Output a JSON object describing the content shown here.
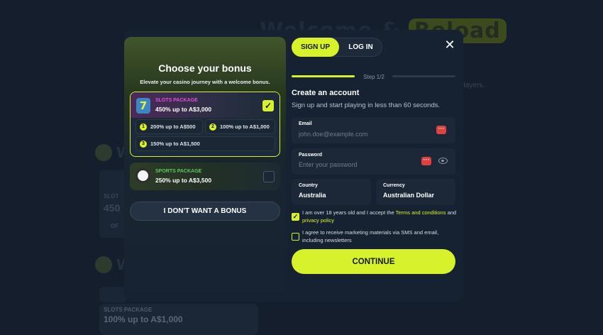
{
  "background": {
    "title_part1": "Welcome &",
    "title_part2": "Reload",
    "subtitle_fragment": "players.",
    "bonus_icon_1_text": "W",
    "bonus_icon_2_text": "W",
    "card1_label": "SLOT",
    "card1_amount": "450",
    "card1_chip": "OF",
    "banner_label": "SLOTS PACKAGE",
    "banner_amount": "100% up to A$1,000"
  },
  "bonus": {
    "title": "Choose your bonus",
    "subtitle": "Elevate your casino journey with a welcome bonus.",
    "slots": {
      "label": "SLOTS PACKAGE",
      "amount": "450% up to A$3,000",
      "icon_glyph": "7",
      "selected": true,
      "tiers": [
        {
          "num": "1",
          "text": "200% up to A$500"
        },
        {
          "num": "2",
          "text": "100% up to A$1,000"
        },
        {
          "num": "3",
          "text": "150% up to A$1,500"
        }
      ]
    },
    "sports": {
      "label": "SPORTS PACKAGE",
      "amount": "250% up to A$3,500",
      "selected": false
    },
    "no_bonus_label": "I DON'T WANT A BONUS"
  },
  "auth": {
    "tabs": {
      "signup": "SIGN UP",
      "login": "LOG IN"
    },
    "close_glyph": "✕",
    "step": "Step 1/2",
    "title": "Create an account",
    "subtitle": "Sign up and start playing in less than 60 seconds.",
    "email": {
      "label": "Email",
      "placeholder": "john.doe@example.com"
    },
    "password": {
      "label": "Password",
      "placeholder": "Enter your password"
    },
    "country": {
      "label": "Country",
      "value": "Australia"
    },
    "currency": {
      "label": "Currency",
      "value": "Australian Dollar"
    },
    "terms": {
      "checked": true,
      "text_before": "I am over 18 years old and I accept the ",
      "link1": "Terms and conditions",
      "text_mid": " and ",
      "link2": "privacy policy"
    },
    "marketing": {
      "checked": false,
      "text": "I agree to receive marketing materials via SMS and email, including newsletters"
    },
    "continue_label": "CONTINUE"
  },
  "colors": {
    "accent": "#d7f22b",
    "modal_bg": "#162232",
    "slots_label": "#e24fd8",
    "sports_label": "#5fc85f",
    "alert_red": "#e0413f"
  }
}
